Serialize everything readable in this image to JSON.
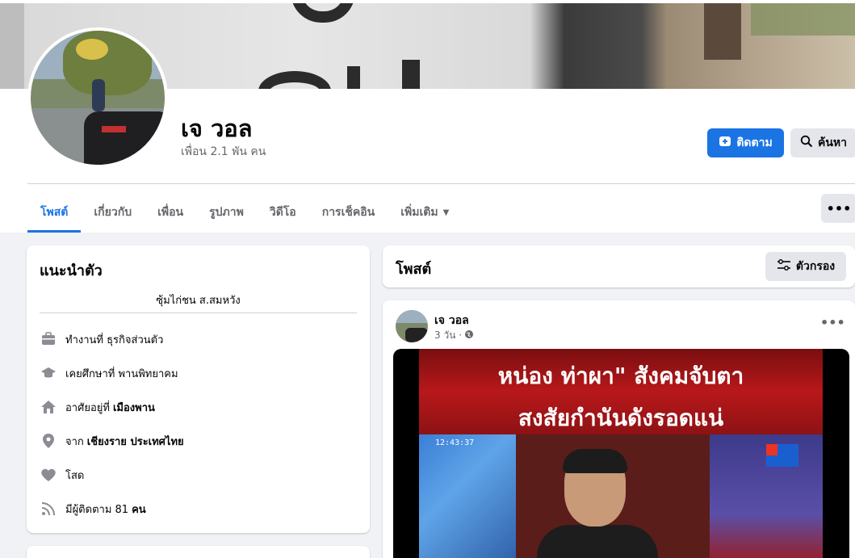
{
  "profile": {
    "name": "เจ วอล",
    "friends": "เพื่อน 2.1 พัน คน",
    "follow_label": "ติดตาม",
    "search_label": "ค้นหา"
  },
  "tabs": [
    {
      "label": "โพสต์",
      "active": true
    },
    {
      "label": "เกี่ยวกับ"
    },
    {
      "label": "เพื่อน"
    },
    {
      "label": "รูปภาพ"
    },
    {
      "label": "วิดีโอ"
    },
    {
      "label": "การเช็คอิน"
    },
    {
      "label": "เพิ่มเติม",
      "caret": true
    }
  ],
  "more_label": "•••",
  "intro": {
    "title": "แนะนำตัว",
    "bio": "ซุ้มไก่ชน ส.สมหวัง",
    "items": [
      {
        "icon": "briefcase-icon",
        "text": "ทำงานที่ ธุรกิจส่วนตัว",
        "bold": ""
      },
      {
        "icon": "graduation-cap-icon",
        "text": "เคยศึกษาที่ พานพิทยาคม",
        "bold": ""
      },
      {
        "icon": "home-icon",
        "text": "อาศัยอยู่ที่",
        "bold": "เมืองพาน"
      },
      {
        "icon": "location-pin-icon",
        "text": "จาก",
        "bold": "เชียงราย ประเทศไทย"
      },
      {
        "icon": "heart-icon",
        "text": "โสด",
        "bold": ""
      },
      {
        "icon": "rss-icon",
        "text": "มีผู้ติดตาม 81",
        "bold": "คน"
      }
    ]
  },
  "posts": {
    "title": "โพสต์",
    "filter_label": "ตัวกรอง"
  },
  "post": {
    "author": "เจ วอล",
    "time": "3 วัน ·",
    "more_label": "•••",
    "image_line1": "หน่อง ท่าผา\" สังคมจับตา",
    "image_line2": "สงสัยกำนันดังรอดแน่",
    "image_time": "12:43:37"
  },
  "colors": {
    "accent": "#1b74e4",
    "secondary_button": "#e4e6eb",
    "page_bg": "#f0f2f5"
  }
}
